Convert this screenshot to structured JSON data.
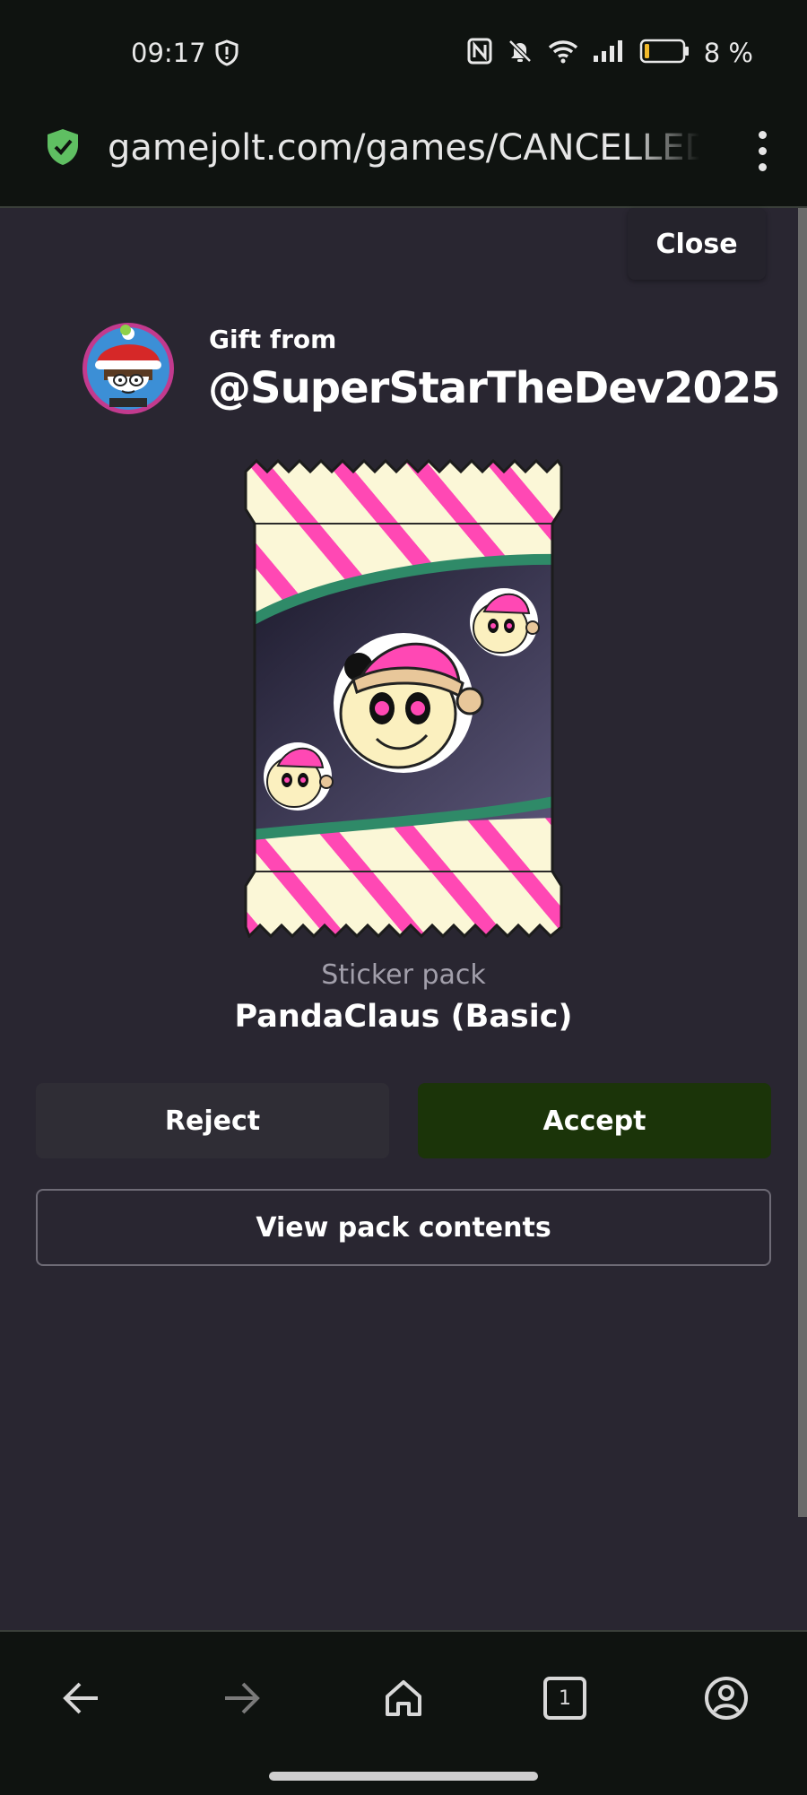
{
  "status_bar": {
    "time": "09:17",
    "battery_percent": "8 %",
    "icons": [
      "shield-icon",
      "nfc-icon",
      "bell-off-icon",
      "wifi-icon",
      "signal-icon",
      "battery-icon"
    ]
  },
  "url_bar": {
    "url": "gamejolt.com/games/CANCELLED",
    "secure_icon": "shield-check-icon",
    "menu_icon": "more-vertical-icon"
  },
  "dialog": {
    "close_label": "Close",
    "gift_from_label": "Gift from",
    "sender": "@SuperStarTheDev2025",
    "pack_type": "Sticker pack",
    "pack_name": "PandaClaus (Basic)",
    "reject_label": "Reject",
    "accept_label": "Accept",
    "view_contents_label": "View pack contents"
  },
  "bottom_nav": {
    "tabs_count": "1",
    "items": [
      "back-icon",
      "forward-icon",
      "home-icon",
      "tabs-icon",
      "account-icon"
    ]
  },
  "colors": {
    "background": "#292631",
    "accept": "#1b3409",
    "pack_stripe": "#ff48b4",
    "pack_band": "#2f8a68"
  }
}
